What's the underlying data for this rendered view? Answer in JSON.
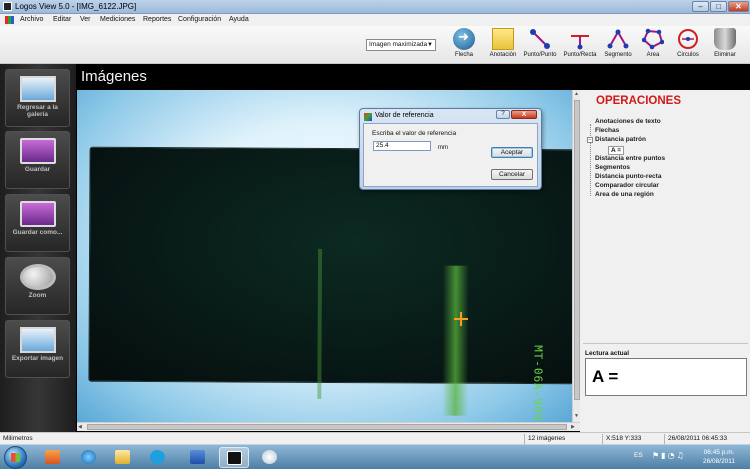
{
  "window": {
    "title": "Logos View 5.0 - [IMG_6122.JPG]",
    "minimize": "–",
    "maximize": "□",
    "close": "✕"
  },
  "menu": [
    "Archivo",
    "Editar",
    "Ver",
    "Mediciones",
    "Reportes",
    "Configuración",
    "Ayuda"
  ],
  "toolbar": {
    "zoom_select": "Imagen maximizada",
    "tools": [
      {
        "label": "Flecha",
        "icon": "arrow-icon"
      },
      {
        "label": "Anotación",
        "icon": "note-icon"
      },
      {
        "label": "Punto/Punto",
        "icon": "point-to-point-icon"
      },
      {
        "label": "Punto/Recta",
        "icon": "point-to-line-icon"
      },
      {
        "label": "Segmento",
        "icon": "segment-icon"
      },
      {
        "label": "Area",
        "icon": "area-icon"
      },
      {
        "label": "Circulos",
        "icon": "circle-icon"
      },
      {
        "label": "Eliminar",
        "icon": "trash-icon"
      }
    ]
  },
  "sidebar": {
    "items": [
      {
        "label": "Regresar a la galería",
        "icon": "gallery-icon"
      },
      {
        "label": "Guardar",
        "icon": "save-icon"
      },
      {
        "label": "Guardar como...",
        "icon": "save-as-icon"
      },
      {
        "label": "Zoom",
        "icon": "magnifier-icon"
      },
      {
        "label": "Exportar imagen",
        "icon": "export-icon"
      }
    ]
  },
  "main": {
    "heading": "Imágenes",
    "plate_text": "MT-06A-909"
  },
  "dialog": {
    "title": "Valor de referencia",
    "help": "?",
    "close": "X",
    "prompt": "Escriba el valor de referencia",
    "value": "25.4",
    "unit": "mm",
    "accept": "Aceptar",
    "cancel": "Cancelar"
  },
  "operations": {
    "title": "OPERACIONES",
    "items": [
      "Anotaciones de texto",
      "Flechas",
      "Distancia patrón",
      "Distancia entre puntos",
      "Segmentos",
      "Distancia punto-recta",
      "Comparador circular",
      "Area de una región"
    ],
    "sub_item": "A ="
  },
  "lectura": {
    "label": "Lectura actual",
    "value": "A ="
  },
  "statusbar": {
    "units": "Milimetros",
    "count": "12 imágenes",
    "coords": "X:518  Y:333",
    "datetime": "26/08/2011 06:45:33"
  },
  "taskbar": {
    "lang": "ES",
    "time": "06:45 p.m.",
    "date": "26/08/2011"
  },
  "colors": {
    "accent_red": "#d01a1a",
    "plate_text_green": "#6fd34a",
    "crosshair_orange": "#f5a020"
  }
}
